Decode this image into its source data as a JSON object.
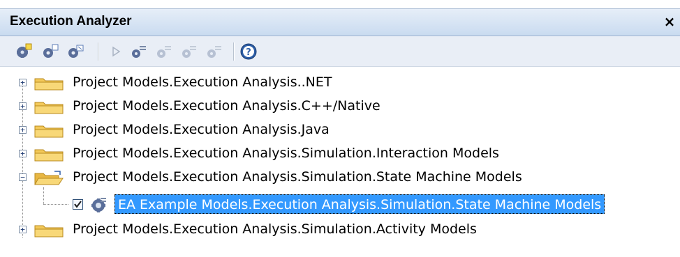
{
  "window": {
    "title": "Execution Analyzer",
    "close_glyph": "×"
  },
  "toolbar": {
    "buttons": [
      {
        "icon": "new-script-icon"
      },
      {
        "icon": "edit-script-icon"
      },
      {
        "icon": "copy-script-icon"
      },
      {
        "icon": "run-icon",
        "disabled": true
      },
      {
        "icon": "build-icon"
      },
      {
        "icon": "test-icon",
        "disabled": true
      },
      {
        "icon": "deploy-icon",
        "disabled": true
      },
      {
        "icon": "debug-icon",
        "disabled": true
      },
      {
        "icon": "help-icon"
      }
    ]
  },
  "tree": {
    "items": [
      {
        "label": "Project Models.Execution Analysis..NET",
        "expanded": false,
        "expander": "+"
      },
      {
        "label": "Project Models.Execution Analysis.C++/Native",
        "expanded": false,
        "expander": "+"
      },
      {
        "label": "Project Models.Execution Analysis.Java",
        "expanded": false,
        "expander": "+"
      },
      {
        "label": "Project Models.Execution Analysis.Simulation.Interaction Models",
        "expanded": false,
        "expander": "+"
      },
      {
        "label": "Project Models.Execution Analysis.Simulation.State Machine Models",
        "expanded": true,
        "expander": "−",
        "children": [
          {
            "label": "EA Example Models.Execution Analysis.Simulation.State Machine Models",
            "checked": true,
            "selected": true
          }
        ]
      },
      {
        "label": "Project Models.Execution Analysis.Simulation.Activity Models",
        "expanded": false,
        "expander": "+"
      }
    ]
  },
  "colors": {
    "titlebar": "#c9dbf0",
    "selection": "#3399ff",
    "folder": "#f3c95a"
  }
}
